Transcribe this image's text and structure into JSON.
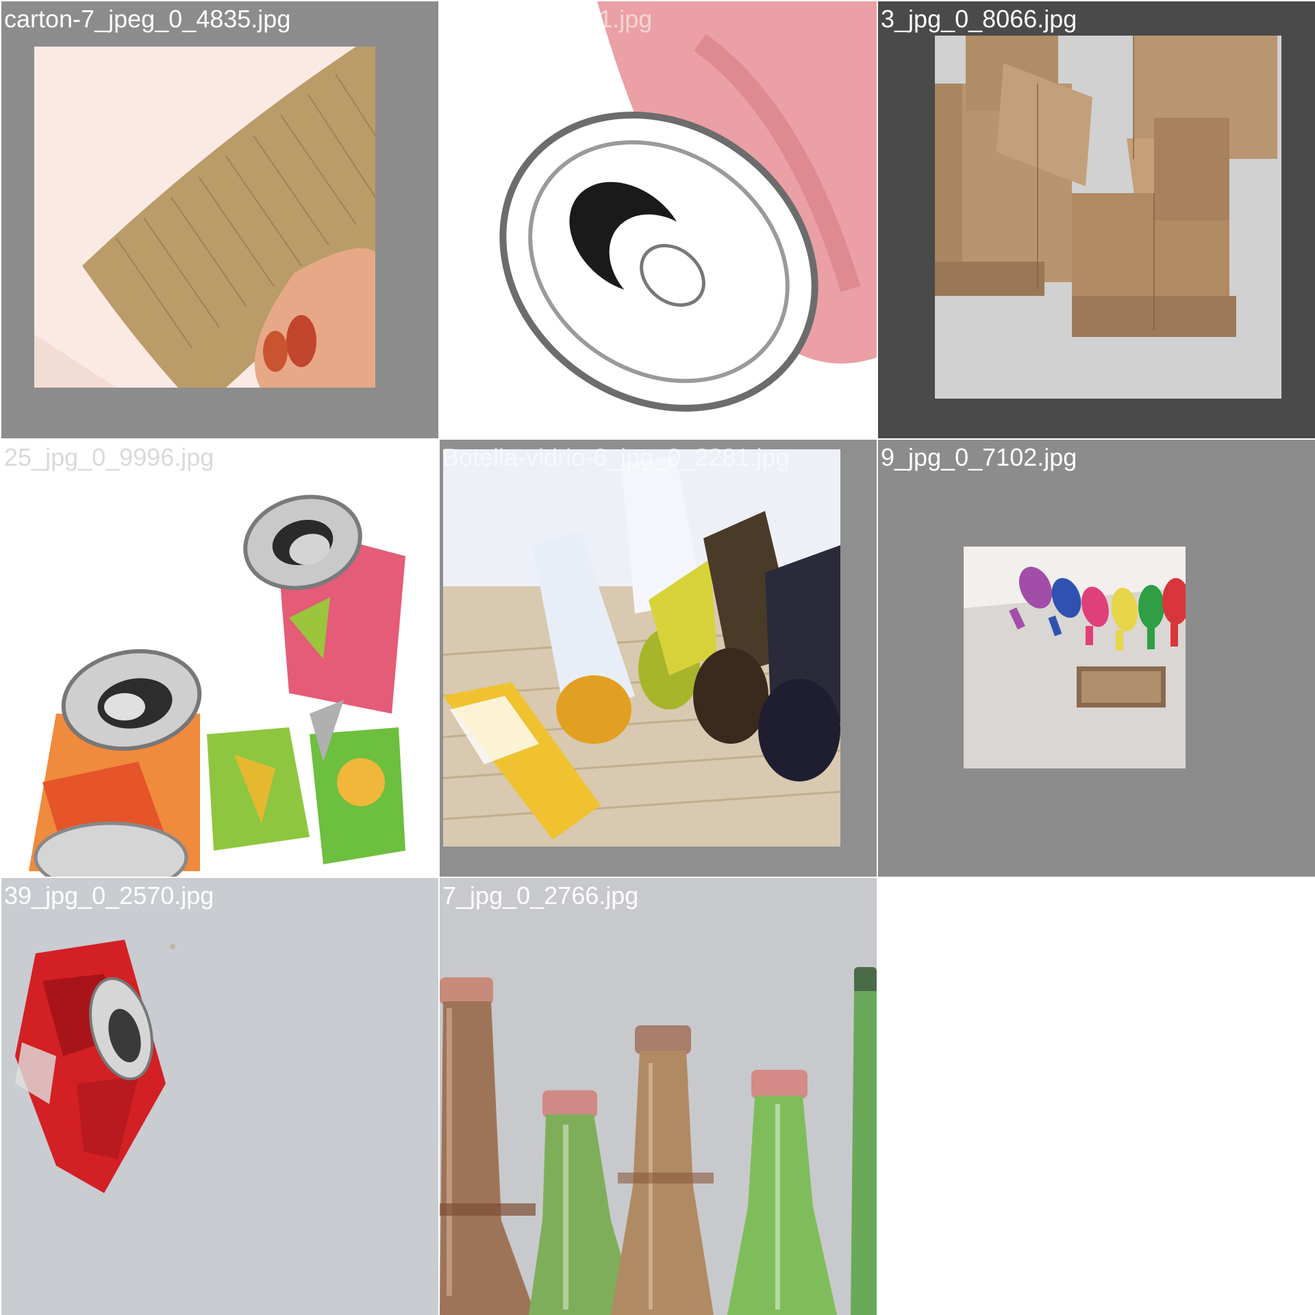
{
  "tiles": [
    {
      "label": "carton-7_jpeg_0_4835.jpg",
      "subject": "corrugated cardboard piece held in hand"
    },
    {
      "label": "26_jpg_0_5991.jpg",
      "subject": "close-up of pink can top, inverted colors"
    },
    {
      "label": "3_jpg_0_8066.jpg",
      "subject": "stacked brown cardboard boxes"
    },
    {
      "label": "25_jpg_0_9996.jpg",
      "subject": "crushed colorful aluminum cans"
    },
    {
      "label": "Botella-vidrio-6_jpg_0_2281.jpg",
      "subject": "glass bottles lying on wooden floor"
    },
    {
      "label": "9_jpg_0_7102.jpg",
      "subject": "colored swing-top glass bottles in crate"
    },
    {
      "label": "39_jpg_0_2570.jpg",
      "subject": "crushed red soda can on grey surface"
    },
    {
      "label": "7_jpg_0_2766.jpg",
      "subject": "necks of green and brown beer bottles"
    }
  ],
  "colors": {
    "grey_pad": "#8c8c8c",
    "dark_pad": "#4a4a4a",
    "cardboard": "#b59a6a",
    "can_pink": "#e0687a"
  }
}
